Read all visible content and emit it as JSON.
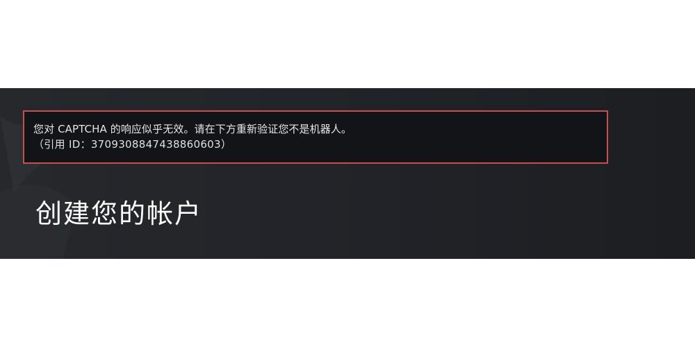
{
  "error": {
    "message": "您对 CAPTCHA 的响应似乎无效。请在下方重新验证您不是机器人。",
    "reference": "（引用 ID：3709308847438860603）"
  },
  "page": {
    "title": "创建您的帐户"
  },
  "colors": {
    "panel_background": "#222429",
    "error_border": "#c64f50",
    "error_background": "#131418",
    "text": "#e6e6e6"
  }
}
